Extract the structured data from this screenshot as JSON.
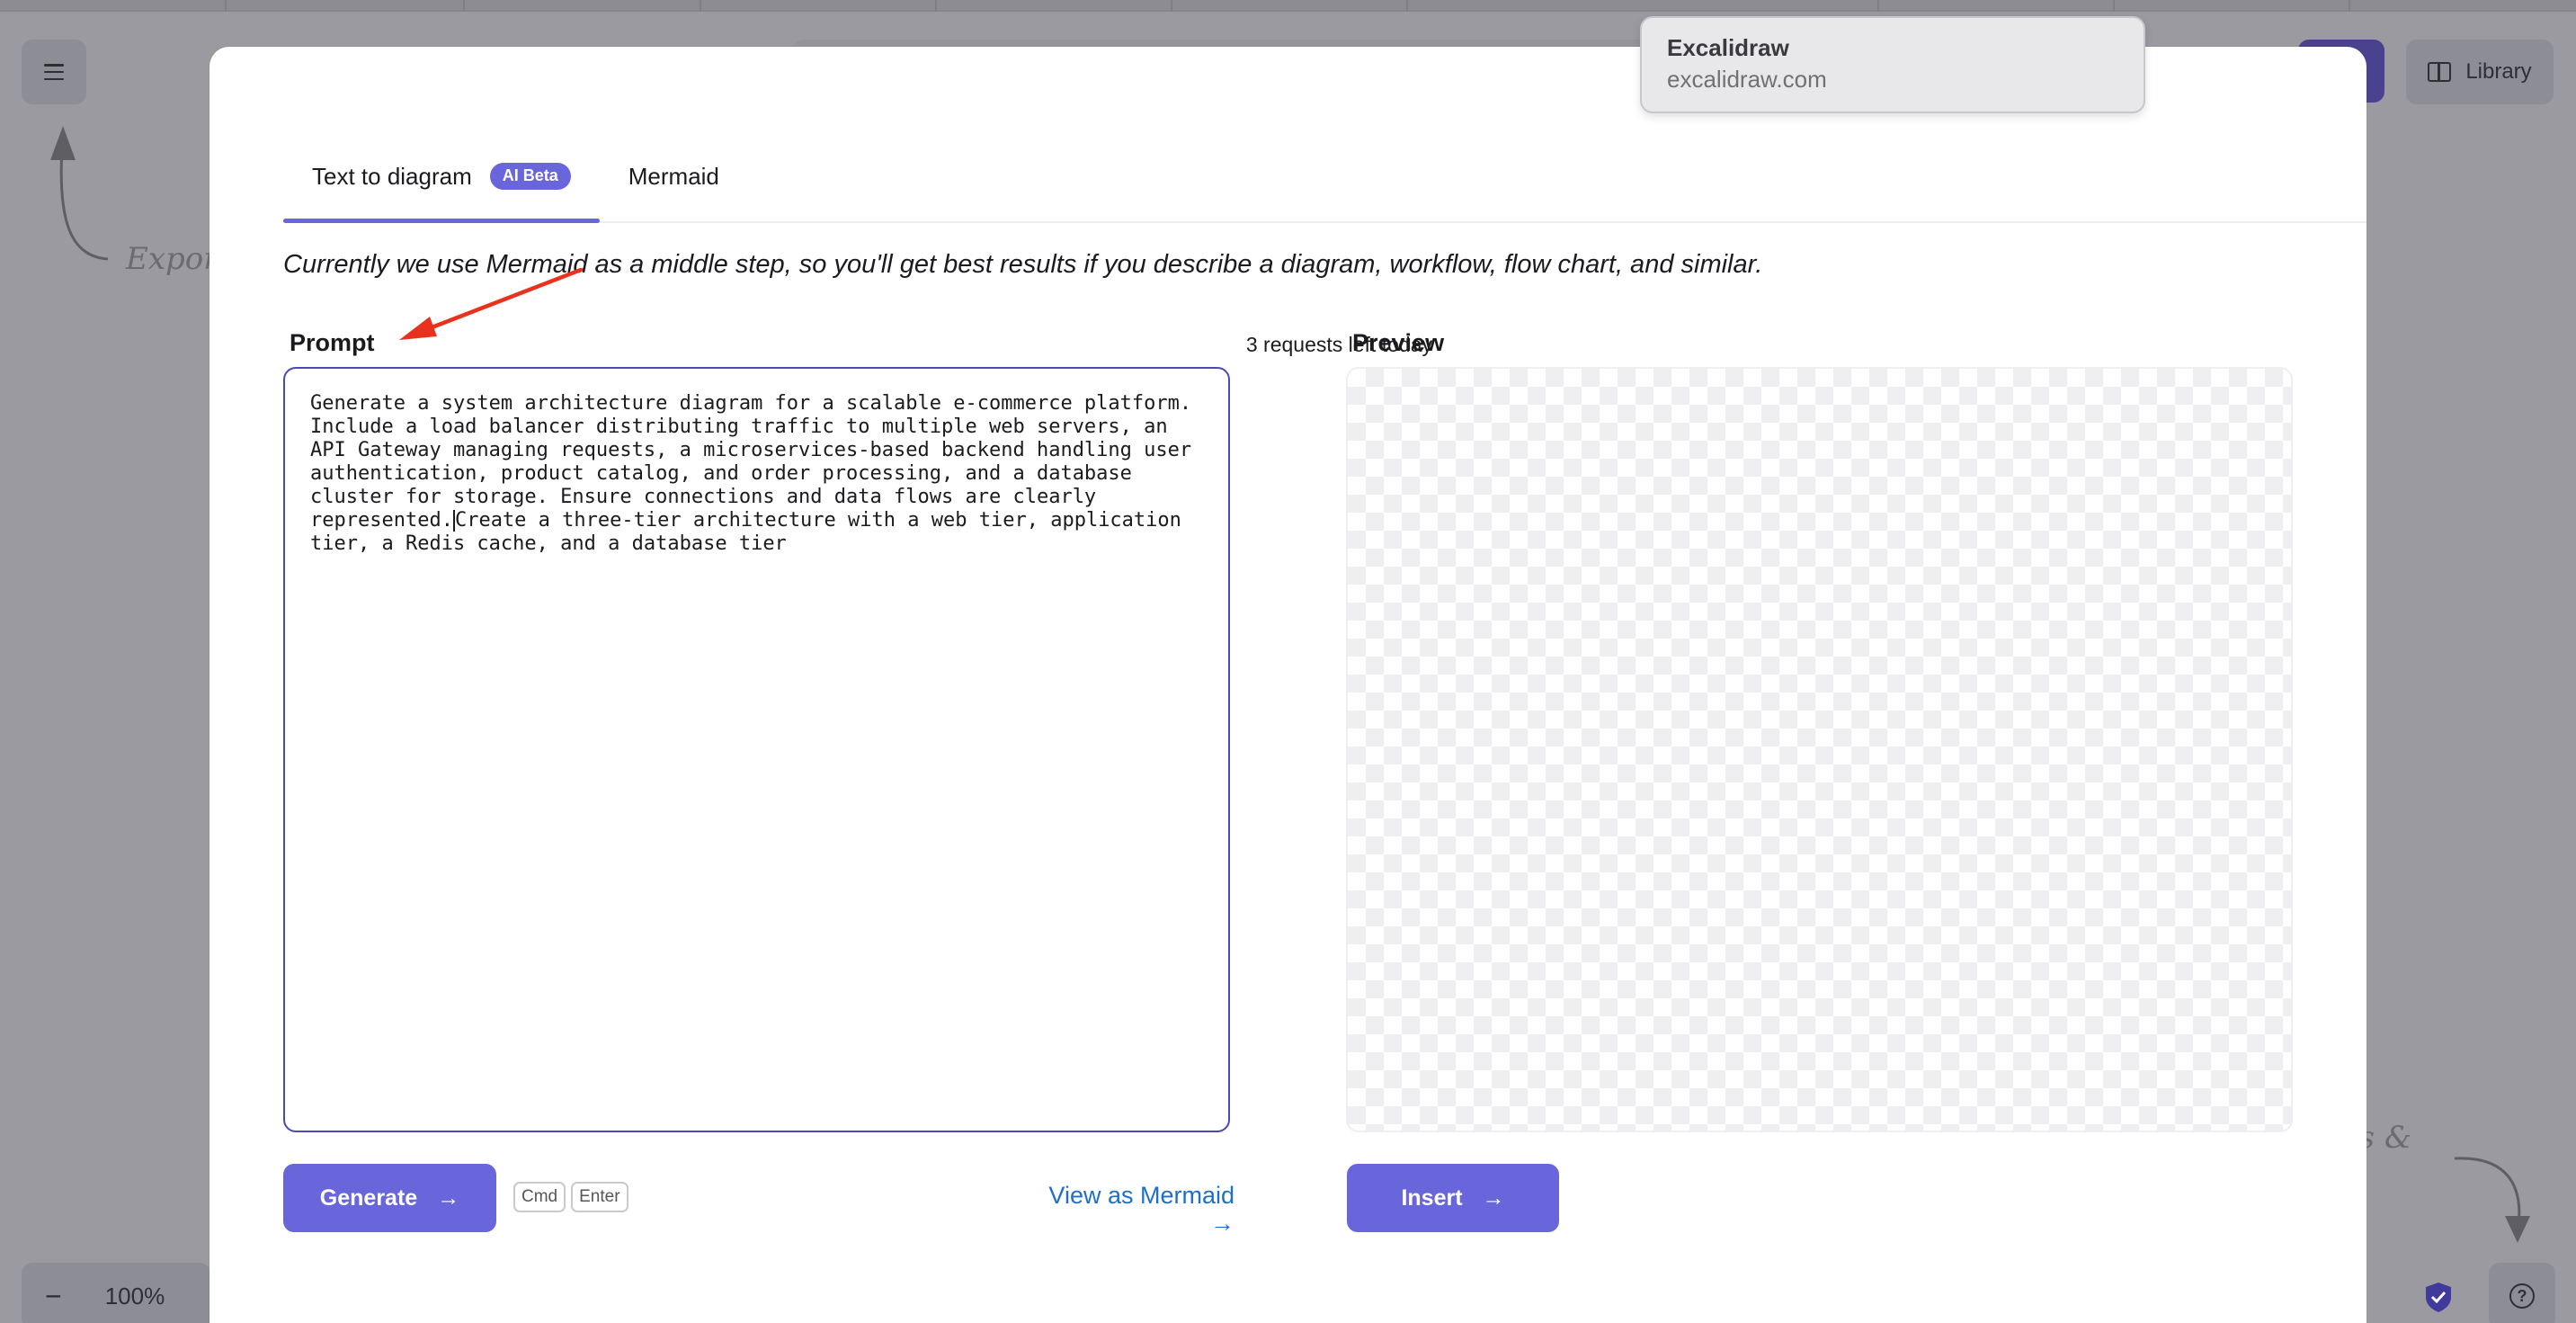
{
  "background": {
    "hint_export": "Expor",
    "hint_shortcuts": "ts &",
    "library_label": "Library",
    "zoom_level": "100%",
    "zoom_out_symbol": "−"
  },
  "dialog": {
    "tabs": [
      {
        "label": "Text to diagram",
        "badge": "AI Beta",
        "active": true
      },
      {
        "label": "Mermaid",
        "active": false
      }
    ],
    "intro": "Currently we use Mermaid as a middle step, so you'll get best results if you describe a diagram, workflow, flow chart, and similar.",
    "prompt_label": "Prompt",
    "requests_left": "3 requests left today",
    "prompt_text_before_caret": "Generate a system architecture diagram for a scalable e-commerce platform.\nInclude a load balancer distributing traffic to multiple web servers, an\nAPI Gateway managing requests, a microservices-based backend handling user\nauthentication, product catalog, and order processing, and a database\ncluster for storage. Ensure connections and data flows are clearly\nrepresented.",
    "prompt_text_after_caret": "Create a three-tier architecture with a web tier, application\ntier, a Redis cache, and a database tier",
    "preview_label": "Preview",
    "generate_label": "Generate",
    "arrow_glyph": "→",
    "kbd_cmd": "Cmd",
    "kbd_enter": "Enter",
    "view_as_mermaid": "View as Mermaid →",
    "insert_label": "Insert"
  },
  "tooltip": {
    "title": "Excalidraw",
    "url": "excalidraw.com"
  },
  "colors": {
    "accent": "#6965db",
    "link": "#1e6fc7",
    "annotation_arrow": "#e8321e"
  }
}
